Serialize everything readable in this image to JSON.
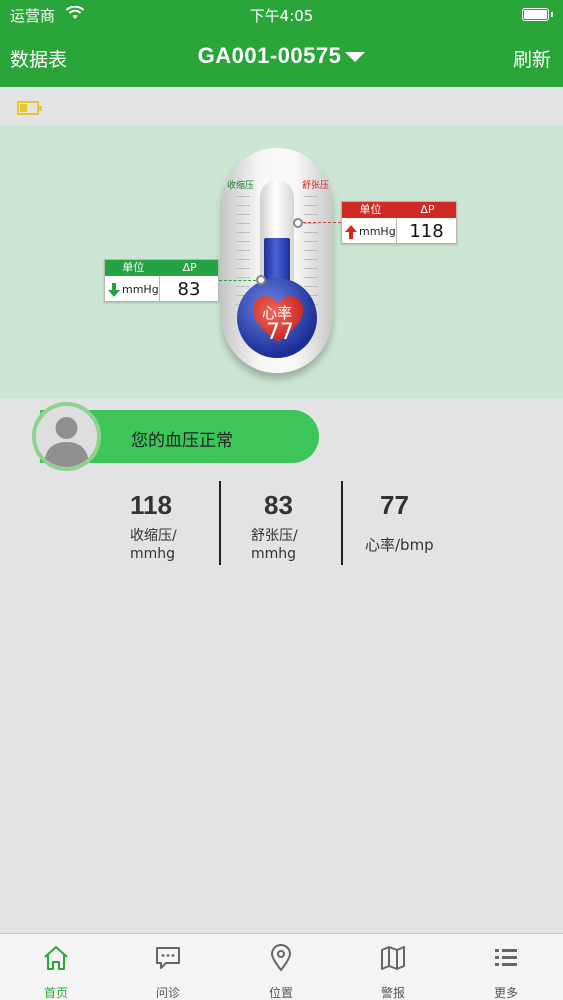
{
  "status_bar": {
    "carrier": "运营商",
    "time": "下午4:05"
  },
  "nav": {
    "left": "数据表",
    "title": "GA001-00575",
    "right": "刷新"
  },
  "thermometer": {
    "systolic_label": "收缩压",
    "diastolic_label": "舒张压",
    "heart_label": "心率",
    "heart_value": "77",
    "fill_level": 0.62
  },
  "callout_high": {
    "unit_header": "单位",
    "delta_header": "ΔP",
    "unit": "mmHg",
    "value": "118",
    "color": "#cf2a24"
  },
  "callout_low": {
    "unit_header": "单位",
    "delta_header": "ΔP",
    "unit": "mmHg",
    "value": "83",
    "color": "#25a244"
  },
  "status_message": "您的血压正常",
  "stats": [
    {
      "value": "118",
      "label_line1": "收缩压/",
      "label_line2": "mmhg"
    },
    {
      "value": "83",
      "label_line1": "舒张压/",
      "label_line2": "mmhg"
    },
    {
      "value": "77",
      "label_line1": "心率/bmp",
      "label_line2": ""
    }
  ],
  "tabs": [
    {
      "label": "首页",
      "icon": "home-icon",
      "active": true
    },
    {
      "label": "问诊",
      "icon": "chat-icon",
      "active": false
    },
    {
      "label": "位置",
      "icon": "location-pin-icon",
      "active": false
    },
    {
      "label": "警报",
      "icon": "map-icon",
      "active": false
    },
    {
      "label": "更多",
      "icon": "list-icon",
      "active": false
    }
  ],
  "colors": {
    "primary": "#2aa539",
    "panel": "#cde6d3",
    "pill": "#3ec55a",
    "battery": "#e8c72a"
  }
}
